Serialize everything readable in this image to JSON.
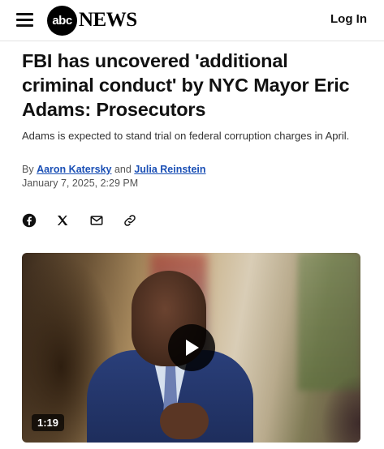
{
  "header": {
    "logo_circle_text": "abc",
    "logo_news_text": "NEWS",
    "login_label": "Log In"
  },
  "article": {
    "headline": "FBI has uncovered 'additional criminal conduct' by NYC Mayor Eric Adams: Prosecutors",
    "subhead": "Adams is expected to stand trial on federal corruption charges in April.",
    "byline_prefix": "By",
    "author_1": "Aaron Katersky",
    "byline_and": "and",
    "author_2": "Julia Reinstein",
    "date": "January 7, 2025, 2:29 PM"
  },
  "share": {
    "icons": [
      "facebook-icon",
      "x-icon",
      "mail-icon",
      "link-icon"
    ]
  },
  "video": {
    "duration": "1:19"
  }
}
